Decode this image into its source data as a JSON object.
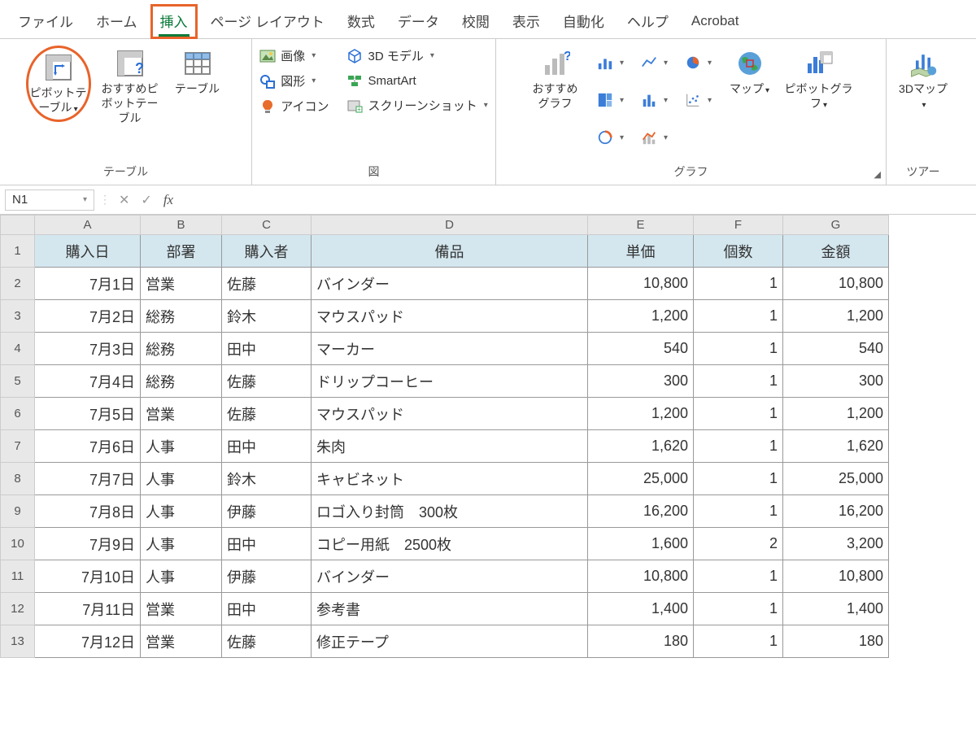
{
  "tabs": {
    "items": [
      "ファイル",
      "ホーム",
      "挿入",
      "ページ レイアウト",
      "数式",
      "データ",
      "校閲",
      "表示",
      "自動化",
      "ヘルプ",
      "Acrobat"
    ],
    "active": "挿入",
    "highlight": "挿入"
  },
  "ribbon": {
    "tables": {
      "label": "テーブル",
      "pivot": "ピボットテーブル",
      "recommended_pivot": "おすすめピボットテーブル",
      "table": "テーブル"
    },
    "illustrations": {
      "label": "図",
      "pictures": "画像",
      "shapes": "図形",
      "icons": "アイコン",
      "models3d": "3D モデル",
      "smartart": "SmartArt",
      "screenshot": "スクリーンショット"
    },
    "charts": {
      "label": "グラフ",
      "recommended": "おすすめグラフ",
      "map": "マップ",
      "pivot_chart": "ピボットグラフ"
    },
    "tours": {
      "label": "ツアー",
      "map3d": "3Dマップ"
    }
  },
  "formula_bar": {
    "name_box": "N1",
    "formula": ""
  },
  "grid": {
    "columns": [
      "A",
      "B",
      "C",
      "D",
      "E",
      "F",
      "G"
    ],
    "col_classes": [
      "cA",
      "cB",
      "cC",
      "cD",
      "cE",
      "cF",
      "cG"
    ],
    "header": [
      "購入日",
      "部署",
      "購入者",
      "備品",
      "単価",
      "個数",
      "金額"
    ],
    "rows": [
      {
        "n": 1,
        "hdr": true
      },
      {
        "n": 2,
        "c": [
          "7月1日",
          "営業",
          "佐藤",
          "バインダー",
          "10,800",
          "1",
          "10,800"
        ]
      },
      {
        "n": 3,
        "c": [
          "7月2日",
          "総務",
          "鈴木",
          "マウスパッド",
          "1,200",
          "1",
          "1,200"
        ]
      },
      {
        "n": 4,
        "c": [
          "7月3日",
          "総務",
          "田中",
          "マーカー",
          "540",
          "1",
          "540"
        ]
      },
      {
        "n": 5,
        "c": [
          "7月4日",
          "総務",
          "佐藤",
          "ドリップコーヒー",
          "300",
          "1",
          "300"
        ]
      },
      {
        "n": 6,
        "c": [
          "7月5日",
          "営業",
          "佐藤",
          "マウスパッド",
          "1,200",
          "1",
          "1,200"
        ]
      },
      {
        "n": 7,
        "c": [
          "7月6日",
          "人事",
          "田中",
          "朱肉",
          "1,620",
          "1",
          "1,620"
        ]
      },
      {
        "n": 8,
        "c": [
          "7月7日",
          "人事",
          "鈴木",
          "キャビネット",
          "25,000",
          "1",
          "25,000"
        ]
      },
      {
        "n": 9,
        "c": [
          "7月8日",
          "人事",
          "伊藤",
          "ロゴ入り封筒　300枚",
          "16,200",
          "1",
          "16,200"
        ]
      },
      {
        "n": 10,
        "c": [
          "7月9日",
          "人事",
          "田中",
          "コピー用紙　2500枚",
          "1,600",
          "2",
          "3,200"
        ]
      },
      {
        "n": 11,
        "c": [
          "7月10日",
          "人事",
          "伊藤",
          "バインダー",
          "10,800",
          "1",
          "10,800"
        ]
      },
      {
        "n": 12,
        "c": [
          "7月11日",
          "営業",
          "田中",
          "参考書",
          "1,400",
          "1",
          "1,400"
        ]
      },
      {
        "n": 13,
        "c": [
          "7月12日",
          "営業",
          "佐藤",
          "修正テープ",
          "180",
          "1",
          "180"
        ]
      }
    ],
    "align": [
      "date",
      "txt",
      "txt",
      "txt",
      "num",
      "num",
      "num"
    ]
  }
}
